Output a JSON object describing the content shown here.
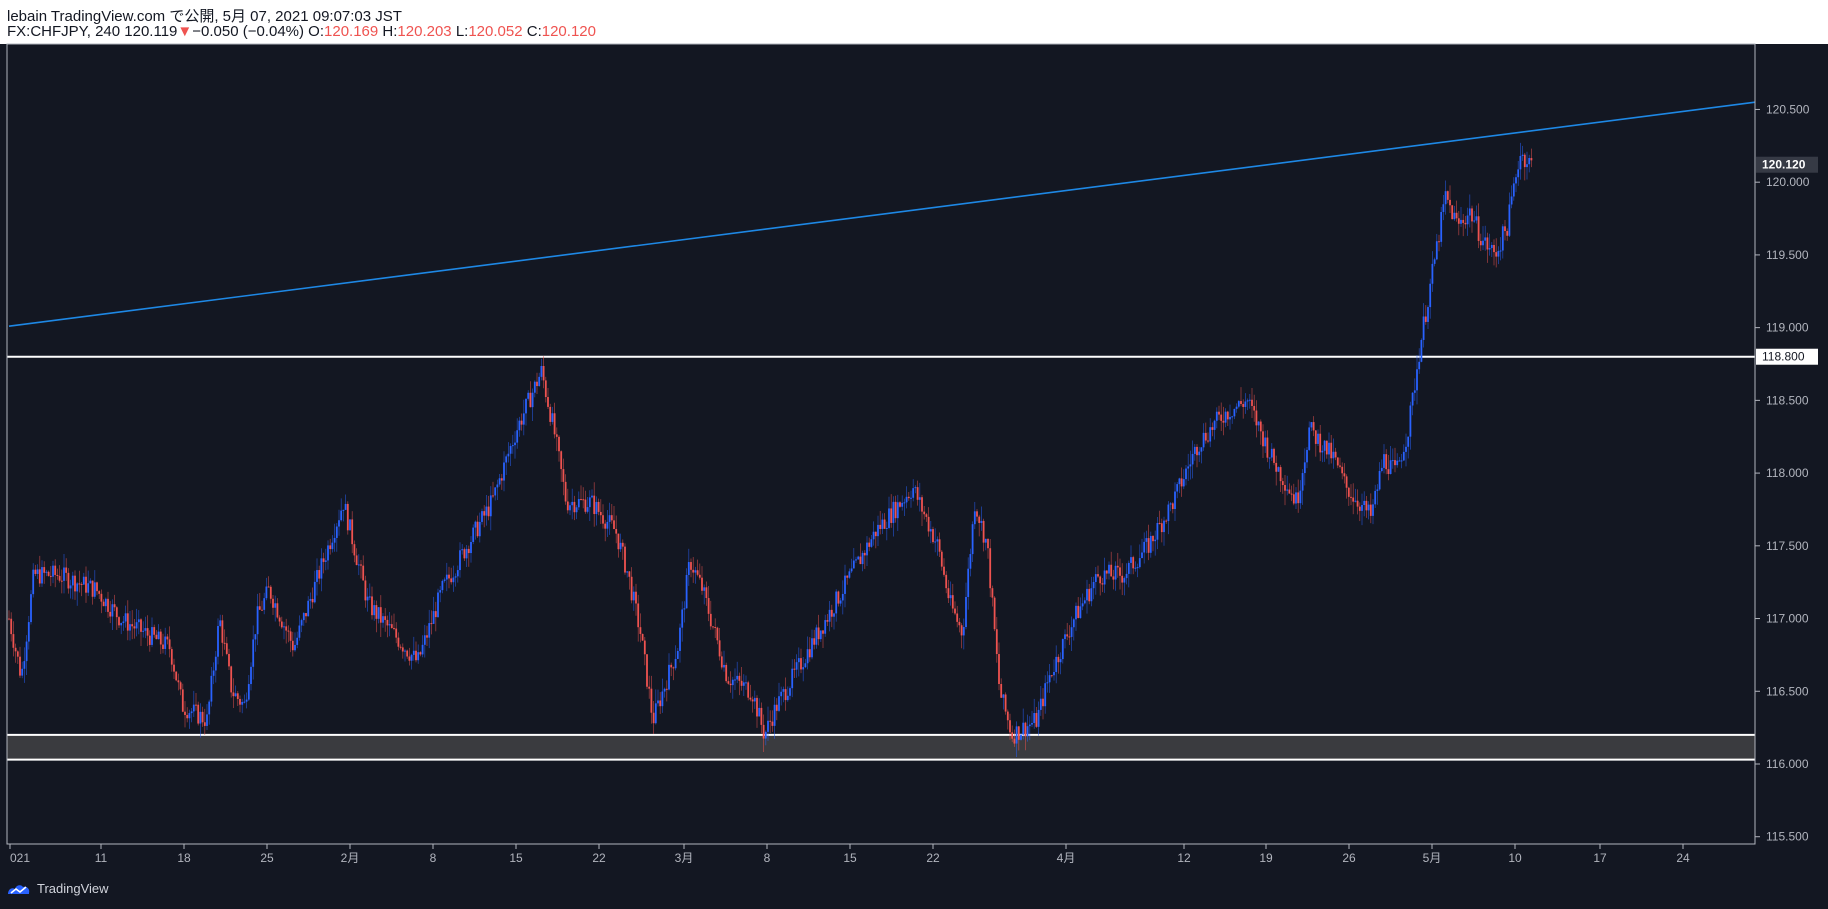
{
  "header": {
    "publisher": "lebain TradingView.com で公開, 5月 07, 2021 09:07:03 JST",
    "symbol": "FX:CHFJPY, 240 120.119",
    "change_arrow": "▼",
    "change": "−0.050 (−0.04%)",
    "o_label": "O:",
    "o_value": "120.169",
    "h_label": "H:",
    "h_value": "120.203",
    "l_label": "L:",
    "l_value": "120.052",
    "c_label": "C:",
    "c_value": "120.120"
  },
  "footer": {
    "brand": "TradingView",
    "logo_icon": "tradingview-logo-icon"
  },
  "colors": {
    "background": "#131722",
    "up": "#2962ff",
    "down": "#ef5350",
    "trendline": "#1e88e5",
    "level": "#ffffff"
  },
  "chart_data": {
    "type": "candlestick",
    "symbol": "FX:CHFJPY",
    "interval": "240",
    "ylim": [
      115.45,
      120.95
    ],
    "y_ticks": [
      "115.500",
      "116.000",
      "116.500",
      "117.000",
      "117.500",
      "118.000",
      "118.500",
      "119.000",
      "119.500",
      "120.000",
      "120.500"
    ],
    "x_ticks": [
      "021",
      "11",
      "18",
      "25",
      "2月",
      "8",
      "15",
      "22",
      "3月",
      "8",
      "15",
      "22",
      "4月",
      "12",
      "19",
      "26",
      "5月",
      "10",
      "17",
      "24"
    ],
    "price_labels": [
      {
        "value": "120.120",
        "price": 120.12,
        "style": "last"
      },
      {
        "value": "118.800",
        "price": 118.8,
        "style": "level"
      }
    ],
    "horizontal_levels": [
      118.8,
      116.2,
      116.03
    ],
    "support_zone": [
      116.03,
      116.2
    ],
    "trendline": {
      "start": {
        "date": "2021-01-04",
        "price": 119.01
      },
      "end": {
        "date": "2021-05-25",
        "price": 120.55
      }
    },
    "close_path": [
      {
        "date": "2021-01-04",
        "price": 117.0
      },
      {
        "date": "2021-01-05",
        "price": 116.6
      },
      {
        "date": "2021-01-06",
        "price": 117.3
      },
      {
        "date": "2021-01-08",
        "price": 117.3
      },
      {
        "date": "2021-01-11",
        "price": 117.2
      },
      {
        "date": "2021-01-13",
        "price": 117.0
      },
      {
        "date": "2021-01-15",
        "price": 116.9
      },
      {
        "date": "2021-01-17",
        "price": 116.8
      },
      {
        "date": "2021-01-18",
        "price": 116.4
      },
      {
        "date": "2021-01-20",
        "price": 116.3
      },
      {
        "date": "2021-01-21",
        "price": 117.0
      },
      {
        "date": "2021-01-22",
        "price": 116.5
      },
      {
        "date": "2021-01-23",
        "price": 116.4
      },
      {
        "date": "2021-01-24",
        "price": 117.0
      },
      {
        "date": "2021-01-25",
        "price": 117.2
      },
      {
        "date": "2021-01-27",
        "price": 116.8
      },
      {
        "date": "2021-01-29",
        "price": 117.3
      },
      {
        "date": "2021-01-31",
        "price": 117.8
      },
      {
        "date": "2021-02-02",
        "price": 117.1
      },
      {
        "date": "2021-02-04",
        "price": 116.9
      },
      {
        "date": "2021-02-06",
        "price": 116.7
      },
      {
        "date": "2021-02-08",
        "price": 117.2
      },
      {
        "date": "2021-02-10",
        "price": 117.5
      },
      {
        "date": "2021-02-12",
        "price": 117.8
      },
      {
        "date": "2021-02-14",
        "price": 118.3
      },
      {
        "date": "2021-02-16",
        "price": 118.7
      },
      {
        "date": "2021-02-17",
        "price": 118.3
      },
      {
        "date": "2021-02-18",
        "price": 117.8
      },
      {
        "date": "2021-02-20",
        "price": 117.8
      },
      {
        "date": "2021-02-22",
        "price": 117.6
      },
      {
        "date": "2021-02-23",
        "price": 117.3
      },
      {
        "date": "2021-02-24",
        "price": 116.9
      },
      {
        "date": "2021-02-25",
        "price": 116.3
      },
      {
        "date": "2021-02-27",
        "price": 116.8
      },
      {
        "date": "2021-02-28",
        "price": 117.4
      },
      {
        "date": "2021-03-01",
        "price": 117.2
      },
      {
        "date": "2021-03-03",
        "price": 116.6
      },
      {
        "date": "2021-03-05",
        "price": 116.5
      },
      {
        "date": "2021-03-06",
        "price": 116.2
      },
      {
        "date": "2021-03-07",
        "price": 116.4
      },
      {
        "date": "2021-03-09",
        "price": 116.7
      },
      {
        "date": "2021-03-11",
        "price": 117.0
      },
      {
        "date": "2021-03-13",
        "price": 117.3
      },
      {
        "date": "2021-03-15",
        "price": 117.6
      },
      {
        "date": "2021-03-18",
        "price": 117.9
      },
      {
        "date": "2021-03-20",
        "price": 117.5
      },
      {
        "date": "2021-03-21",
        "price": 117.1
      },
      {
        "date": "2021-03-22",
        "price": 116.9
      },
      {
        "date": "2021-03-23",
        "price": 117.8
      },
      {
        "date": "2021-03-24",
        "price": 117.5
      },
      {
        "date": "2021-03-25",
        "price": 116.5
      },
      {
        "date": "2021-03-26",
        "price": 116.2
      },
      {
        "date": "2021-03-28",
        "price": 116.3
      },
      {
        "date": "2021-03-29",
        "price": 116.6
      },
      {
        "date": "2021-03-31",
        "price": 117.0
      },
      {
        "date": "2021-04-02",
        "price": 117.3
      },
      {
        "date": "2021-04-04",
        "price": 117.3
      },
      {
        "date": "2021-04-06",
        "price": 117.5
      },
      {
        "date": "2021-04-08",
        "price": 117.8
      },
      {
        "date": "2021-04-10",
        "price": 118.2
      },
      {
        "date": "2021-04-12",
        "price": 118.4
      },
      {
        "date": "2021-04-14",
        "price": 118.5
      },
      {
        "date": "2021-04-16",
        "price": 118.1
      },
      {
        "date": "2021-04-18",
        "price": 117.8
      },
      {
        "date": "2021-04-19",
        "price": 118.3
      },
      {
        "date": "2021-04-21",
        "price": 118.1
      },
      {
        "date": "2021-04-22",
        "price": 117.9
      },
      {
        "date": "2021-04-24",
        "price": 117.7
      },
      {
        "date": "2021-04-25",
        "price": 118.1
      },
      {
        "date": "2021-04-26",
        "price": 118.0
      },
      {
        "date": "2021-04-27",
        "price": 118.3
      },
      {
        "date": "2021-04-28",
        "price": 118.9
      },
      {
        "date": "2021-04-29",
        "price": 119.4
      },
      {
        "date": "2021-04-30",
        "price": 119.9
      },
      {
        "date": "2021-05-01",
        "price": 119.7
      },
      {
        "date": "2021-05-02",
        "price": 119.8
      },
      {
        "date": "2021-05-03",
        "price": 119.6
      },
      {
        "date": "2021-05-04",
        "price": 119.5
      },
      {
        "date": "2021-05-05",
        "price": 119.7
      },
      {
        "date": "2021-05-06",
        "price": 120.2
      },
      {
        "date": "2021-05-07",
        "price": 120.12
      }
    ]
  }
}
